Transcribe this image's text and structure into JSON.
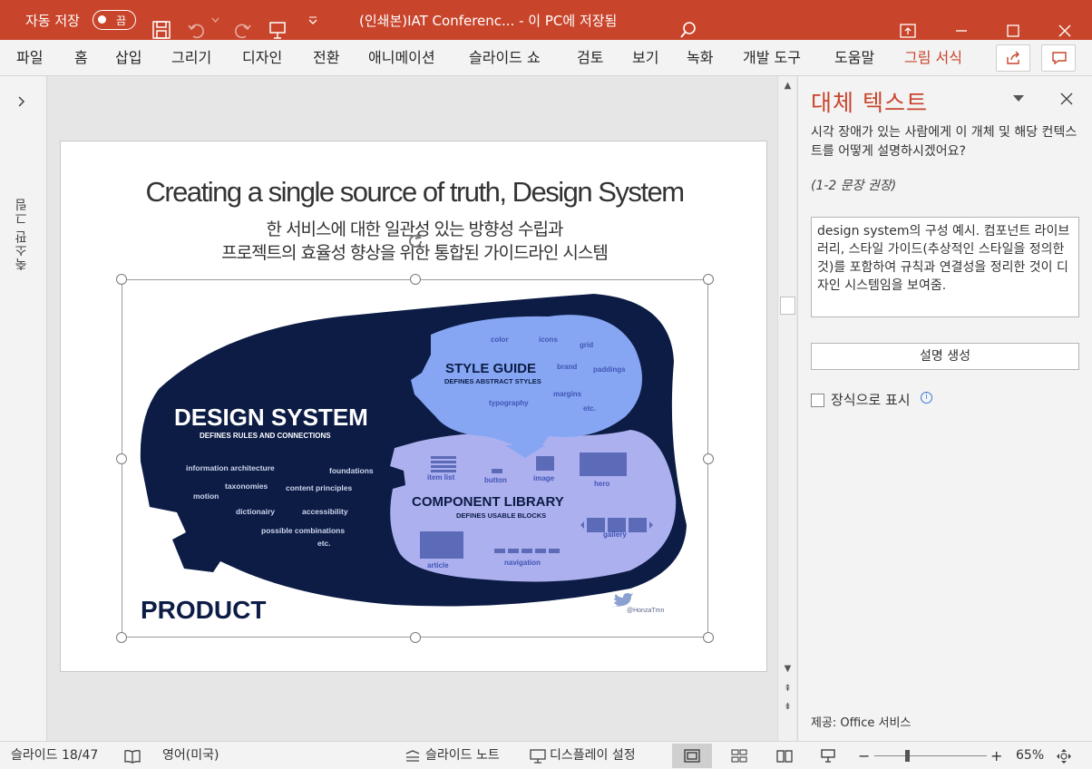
{
  "titlebar": {
    "autosave_label": "자동 저장",
    "autosave_state": "끔",
    "doc_title": "(인쇄본)IAT Conferenc...  -  이 PC에 저장됨",
    "bg_color": "#c8452c"
  },
  "ribbon": {
    "tabs": [
      "파일",
      "홈",
      "삽입",
      "그리기",
      "디자인",
      "전환",
      "애니메이션",
      "슬라이드 쇼",
      "검토",
      "보기",
      "녹화",
      "개발 도구",
      "도움말",
      "그림 서식"
    ],
    "active_tab": "그림 서식"
  },
  "left_panel": {
    "label": "축소판 그림"
  },
  "slide": {
    "title": "Creating a single source of truth, Design System",
    "subtitle_line1": "한 서비스에 대한 일관성 있는 방향성 수립과",
    "subtitle_line2": "프로젝트의 효율성 향상을 위한 통합된 가이드라인 시스템",
    "image": {
      "design_system": "DESIGN SYSTEM",
      "design_system_sub": "DEFINES RULES AND CONNECTIONS",
      "style_guide": "STYLE GUIDE",
      "style_guide_sub": "DEFINES ABSTRACT STYLES",
      "component_library": "COMPONENT LIBRARY",
      "component_library_sub": "DEFINES USABLE BLOCKS",
      "product": "PRODUCT",
      "twitter": "@HonzaTmn",
      "ds_items": [
        "information architecture",
        "foundations",
        "taxonomies",
        "content principles",
        "motion",
        "dictionairy",
        "accessibility",
        "possible combinations",
        "etc."
      ],
      "sg_items": [
        "color",
        "icons",
        "grid",
        "brand",
        "paddings",
        "typography",
        "margins",
        "etc."
      ],
      "cl_items": [
        "item list",
        "button",
        "image",
        "hero",
        "gallery",
        "article",
        "navigation"
      ],
      "colors": {
        "navy": "#0c1c45",
        "style_guide": "#86a6f3",
        "component_library": "#adb0ef",
        "label": "#3f55b5"
      }
    }
  },
  "pane": {
    "title": "대체 텍스트",
    "description": "시각 장애가 있는 사람에게 이 개체 및 해당 컨텍스트를 어떻게 설명하시겠어요?",
    "hint": "(1-2 문장 권장)",
    "alt_text": "design system의 구성 예시. 컴포넌트 라이브러리, 스타일 가이드(추상적인 스타일을 정의한 것)를 포함하여 규칙과 연결성을 정리한 것이 디자인 시스템임을 보여줌.",
    "generate_button": "설명 생성",
    "decorative_label": "장식으로 표시",
    "provider": "제공: Office 서비스"
  },
  "statusbar": {
    "slide_info": "슬라이드 18/47",
    "language": "영어(미국)",
    "notes": "슬라이드 노트",
    "display": "디스플레이 설정",
    "zoom": "65%"
  }
}
